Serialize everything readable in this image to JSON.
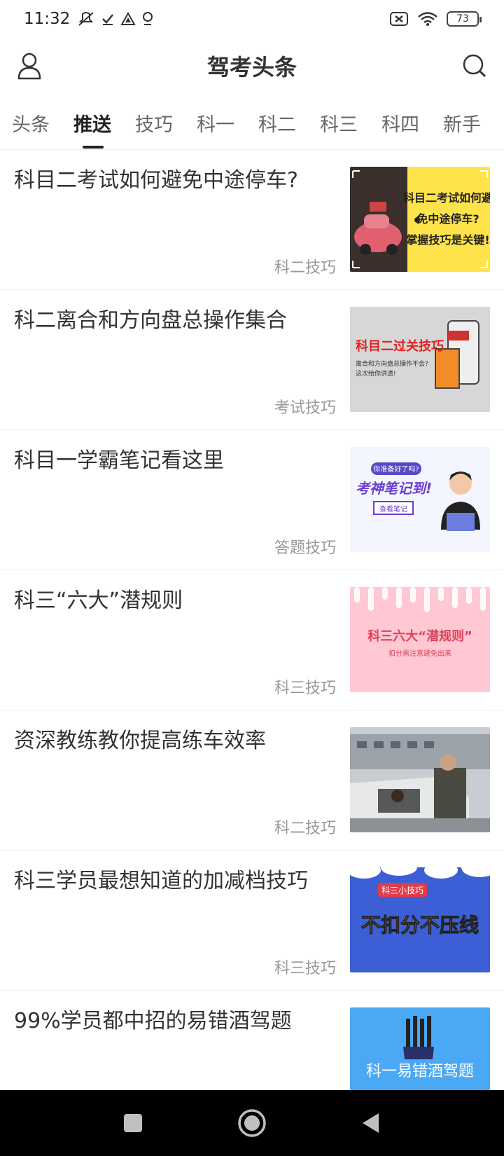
{
  "status_bar": {
    "time": "11:32",
    "battery": "73"
  },
  "header": {
    "title": "驾考头条",
    "profile_icon": "user-icon",
    "search_icon": "search-icon"
  },
  "tabs": [
    {
      "label": "头条",
      "active": false
    },
    {
      "label": "推送",
      "active": true
    },
    {
      "label": "技巧",
      "active": false
    },
    {
      "label": "科一",
      "active": false
    },
    {
      "label": "科二",
      "active": false
    },
    {
      "label": "科三",
      "active": false
    },
    {
      "label": "科四",
      "active": false
    },
    {
      "label": "新手",
      "active": false
    }
  ],
  "articles": [
    {
      "title": "科目二考试如何避免中途停车?",
      "tag": "科二技巧",
      "thumb_text_lines": [
        "科目二考试如何避",
        "免中途停车?",
        "掌握技巧是关键!"
      ]
    },
    {
      "title": "科二离合和方向盘总操作集合",
      "tag": "考试技巧",
      "thumb_text_lines": [
        "科目二过关技巧",
        "离合和方向盘总操作不会?",
        "这次给你讲透!"
      ]
    },
    {
      "title": "科目一学霸笔记看这里",
      "tag": "答题技巧",
      "thumb_text_lines": [
        "你准备好了吗?",
        "考神笔记到!",
        "查看笔记"
      ]
    },
    {
      "title": "科三“六大”潜规则",
      "tag": "科三技巧",
      "thumb_text_lines": [
        "科三六大“潜规则”",
        "扣分需注意避免出来"
      ]
    },
    {
      "title": "资深教练教你提高练车效率",
      "tag": "科二技巧",
      "thumb_text_lines": []
    },
    {
      "title": "科三学员最想知道的加减档技巧",
      "tag": "科三技巧",
      "thumb_text_lines": [
        "科三小技巧",
        "不扣分不压线"
      ]
    },
    {
      "title": "99%学员都中招的易错酒驾题",
      "tag": "",
      "thumb_text_lines": [
        "科一易错酒驾题"
      ]
    }
  ],
  "nav": {
    "recents": "recents-square-icon",
    "home": "home-circle-icon",
    "back": "back-triangle-icon"
  },
  "colors": {
    "thumb1_bg": "#ffe34a",
    "thumb2_bg": "#d7d7d7",
    "thumb3_bg": "#f4f6ff",
    "thumb4_bg": "#ffc8d2",
    "thumb6_bg": "#3c5fd6",
    "thumb7_bg": "#4aa8f4",
    "nav_bg": "#000000"
  }
}
